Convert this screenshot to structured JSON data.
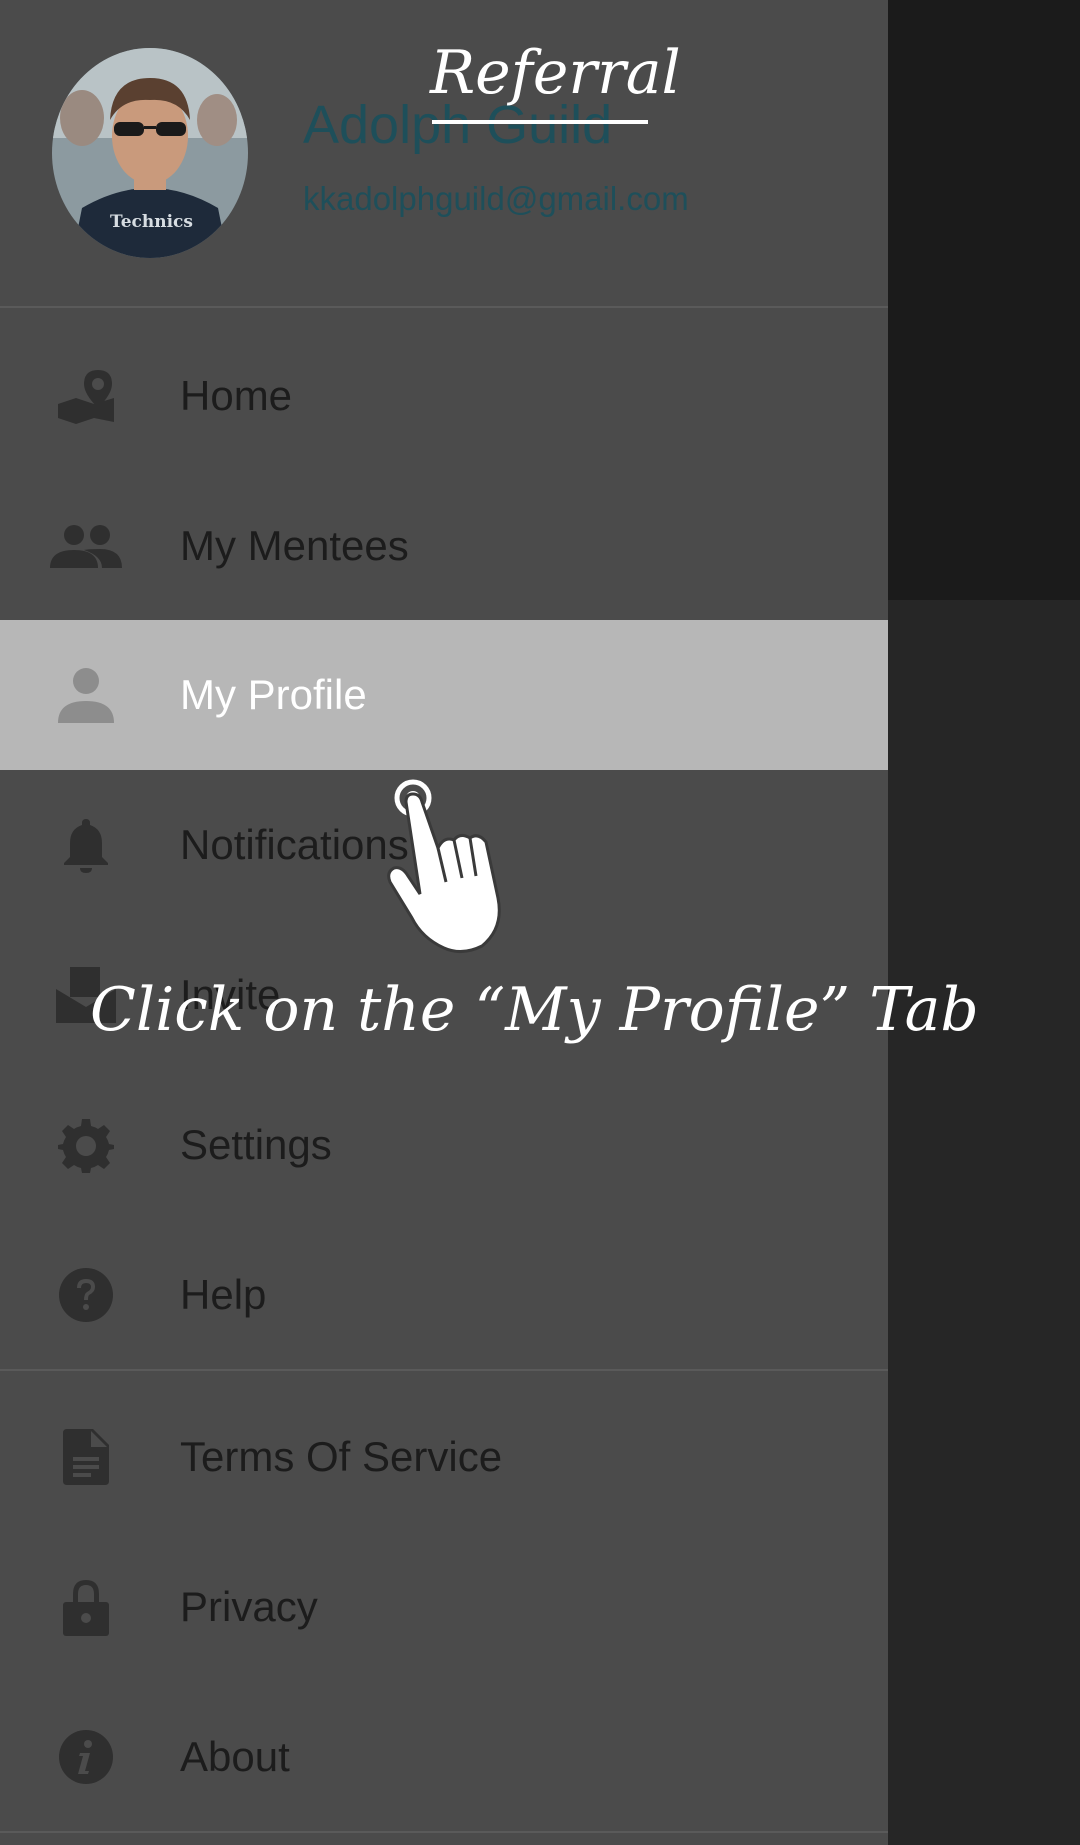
{
  "overlay": {
    "title": "Referral",
    "instruction": "Click on the “My Profile” Tab"
  },
  "profile": {
    "name": "Adolph Guild",
    "email": "kkadolphguild@gmail.com",
    "avatar_text": "Technics"
  },
  "menu": {
    "items": [
      {
        "label": "Home",
        "icon": "map-marker-icon"
      },
      {
        "label": "My Mentees",
        "icon": "people-icon"
      },
      {
        "label": "My Profile",
        "icon": "person-icon",
        "selected": true
      },
      {
        "label": "Notifications",
        "icon": "bell-icon"
      },
      {
        "label": "Invite",
        "icon": "invite-mail-icon"
      },
      {
        "label": "Settings",
        "icon": "gear-icon"
      },
      {
        "label": "Help",
        "icon": "help-icon"
      },
      {
        "label": "Terms Of Service",
        "icon": "document-icon"
      },
      {
        "label": "Privacy",
        "icon": "lock-icon"
      },
      {
        "label": "About",
        "icon": "info-icon"
      }
    ]
  },
  "colors": {
    "drawer_bg": "#4b4b4b",
    "selected_bg": "#b7b7b7",
    "accent_text": "#1e4f5a",
    "overlay_text": "#ffffff"
  }
}
